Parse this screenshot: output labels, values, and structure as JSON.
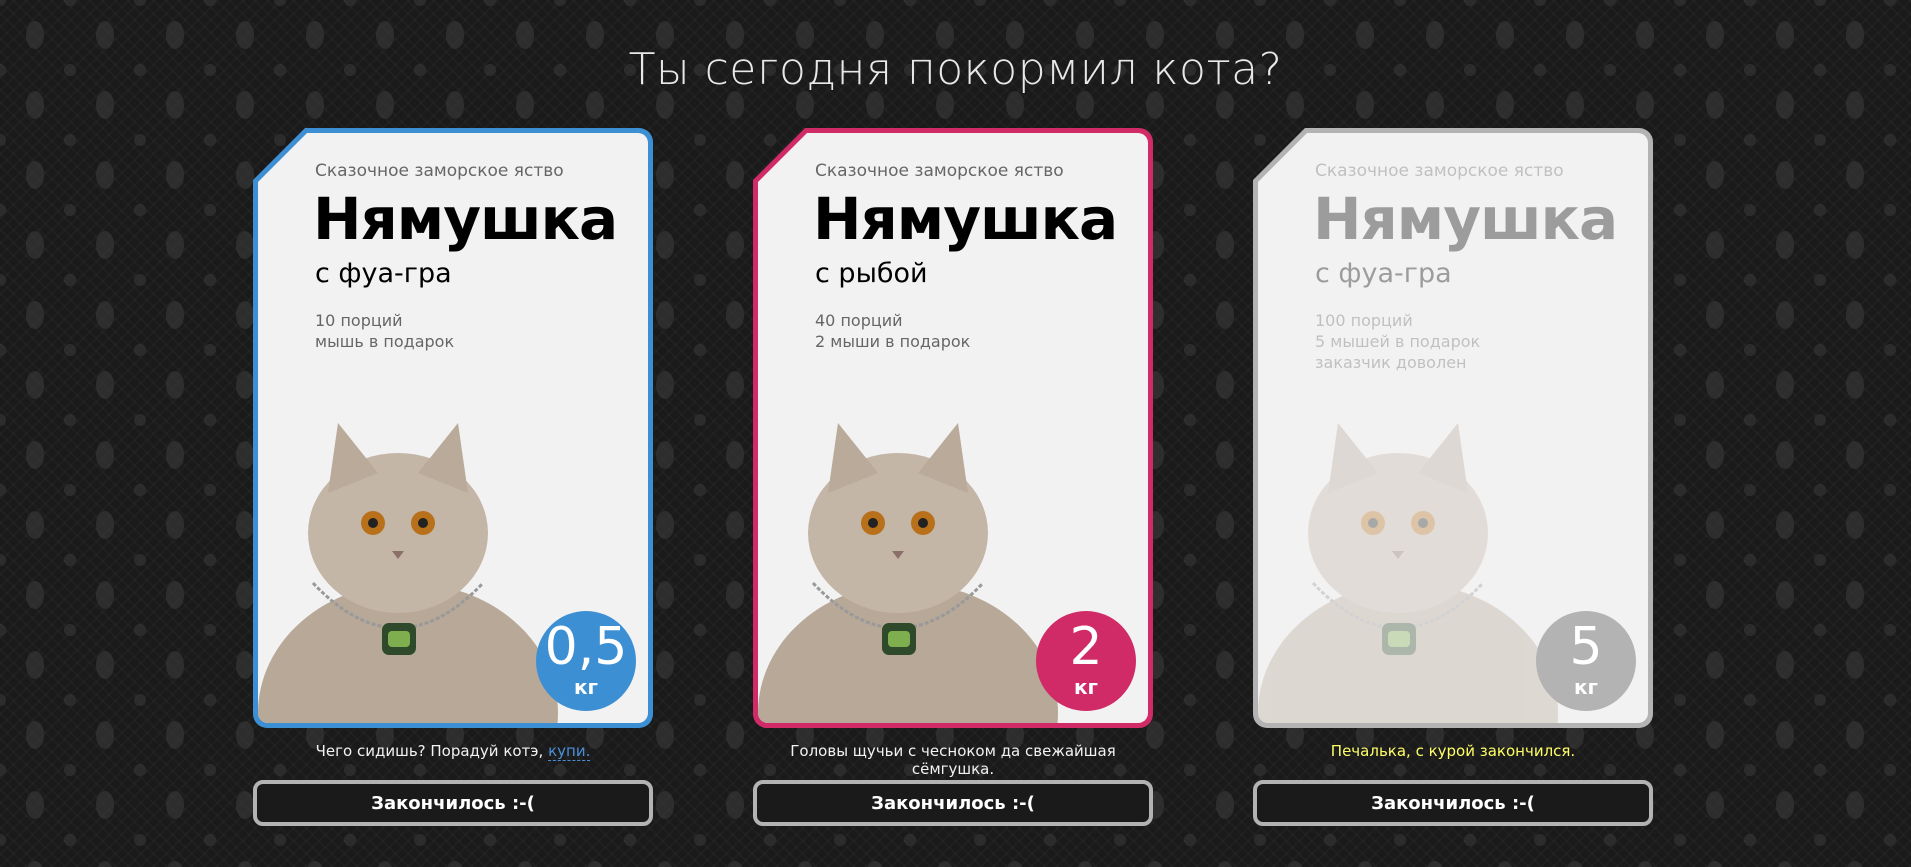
{
  "header": {
    "title": "Ты сегодня покормил кота?"
  },
  "products": [
    {
      "tagline": "Сказочное заморское яство",
      "brand": "Нямушка",
      "flavor": "с фуа-гра",
      "details": [
        "10 порций",
        "мышь в подарок"
      ],
      "weight_value": "0,5",
      "weight_unit": "кг",
      "accent_color": "#3d8fd4",
      "state": "default",
      "caption_text": "Чего сидишь? Порадуй котэ, ",
      "caption_link": "купи.",
      "caption_color": "#f2f2f2",
      "button_label": "Закончилось :-("
    },
    {
      "tagline": "Сказочное заморское яство",
      "brand": "Нямушка",
      "flavor": "с рыбой",
      "details": [
        "40 порций",
        "2 мыши в подарок"
      ],
      "weight_value": "2",
      "weight_unit": "кг",
      "accent_color": "#d02b66",
      "state": "selected",
      "caption_text": "Головы щучьи с чесноком да свежайшая сёмгушка.",
      "caption_link": "",
      "caption_color": "#f2f2f2",
      "button_label": "Закончилось :-("
    },
    {
      "tagline": "Сказочное заморское яство",
      "brand": "Нямушка",
      "flavor": "с фуа-гра",
      "details": [
        "100 порций",
        "5 мышей в подарок",
        "заказчик доволен"
      ],
      "weight_value": "5",
      "weight_unit": "кг",
      "accent_color": "#b3b3b3",
      "state": "disabled",
      "caption_text": "Печалька, с курой закончился.",
      "caption_link": "",
      "caption_color": "#ffff66",
      "button_label": "Закончилось :-("
    }
  ]
}
